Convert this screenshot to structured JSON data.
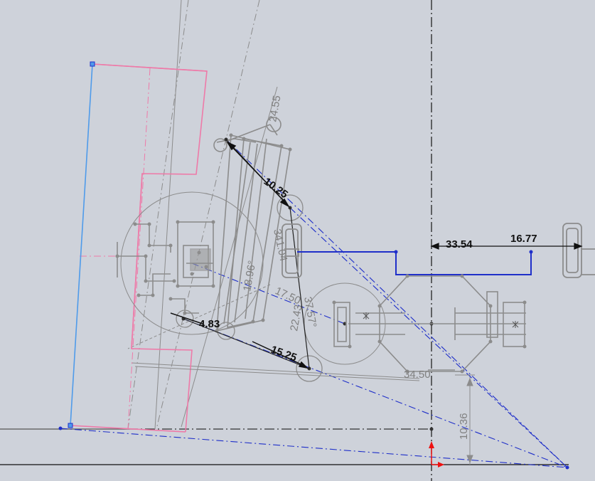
{
  "sketch": {
    "colors": {
      "background": "#ced2da",
      "construction": "#8c8c8c",
      "defined": "#111111",
      "selected": "#1f2fc9",
      "pink": "#ee7aa8",
      "light_blue": "#4f9bea",
      "axis_red": "#e11"
    },
    "dimensions": {
      "d_10_25": "10.25",
      "d_33_54": "33.54",
      "d_16_77": "16.77",
      "d_4_83": "4.83",
      "d_15_25": "15.25",
      "d_24_55": "24.55",
      "d_341_04": "341.04",
      "d_18_96": "18.96°",
      "d_17_50": "17.50",
      "d_22_43": "22.43",
      "d_37_57": "37.57°",
      "d_34_50": "34.50",
      "d_10_36": "10.36"
    }
  }
}
